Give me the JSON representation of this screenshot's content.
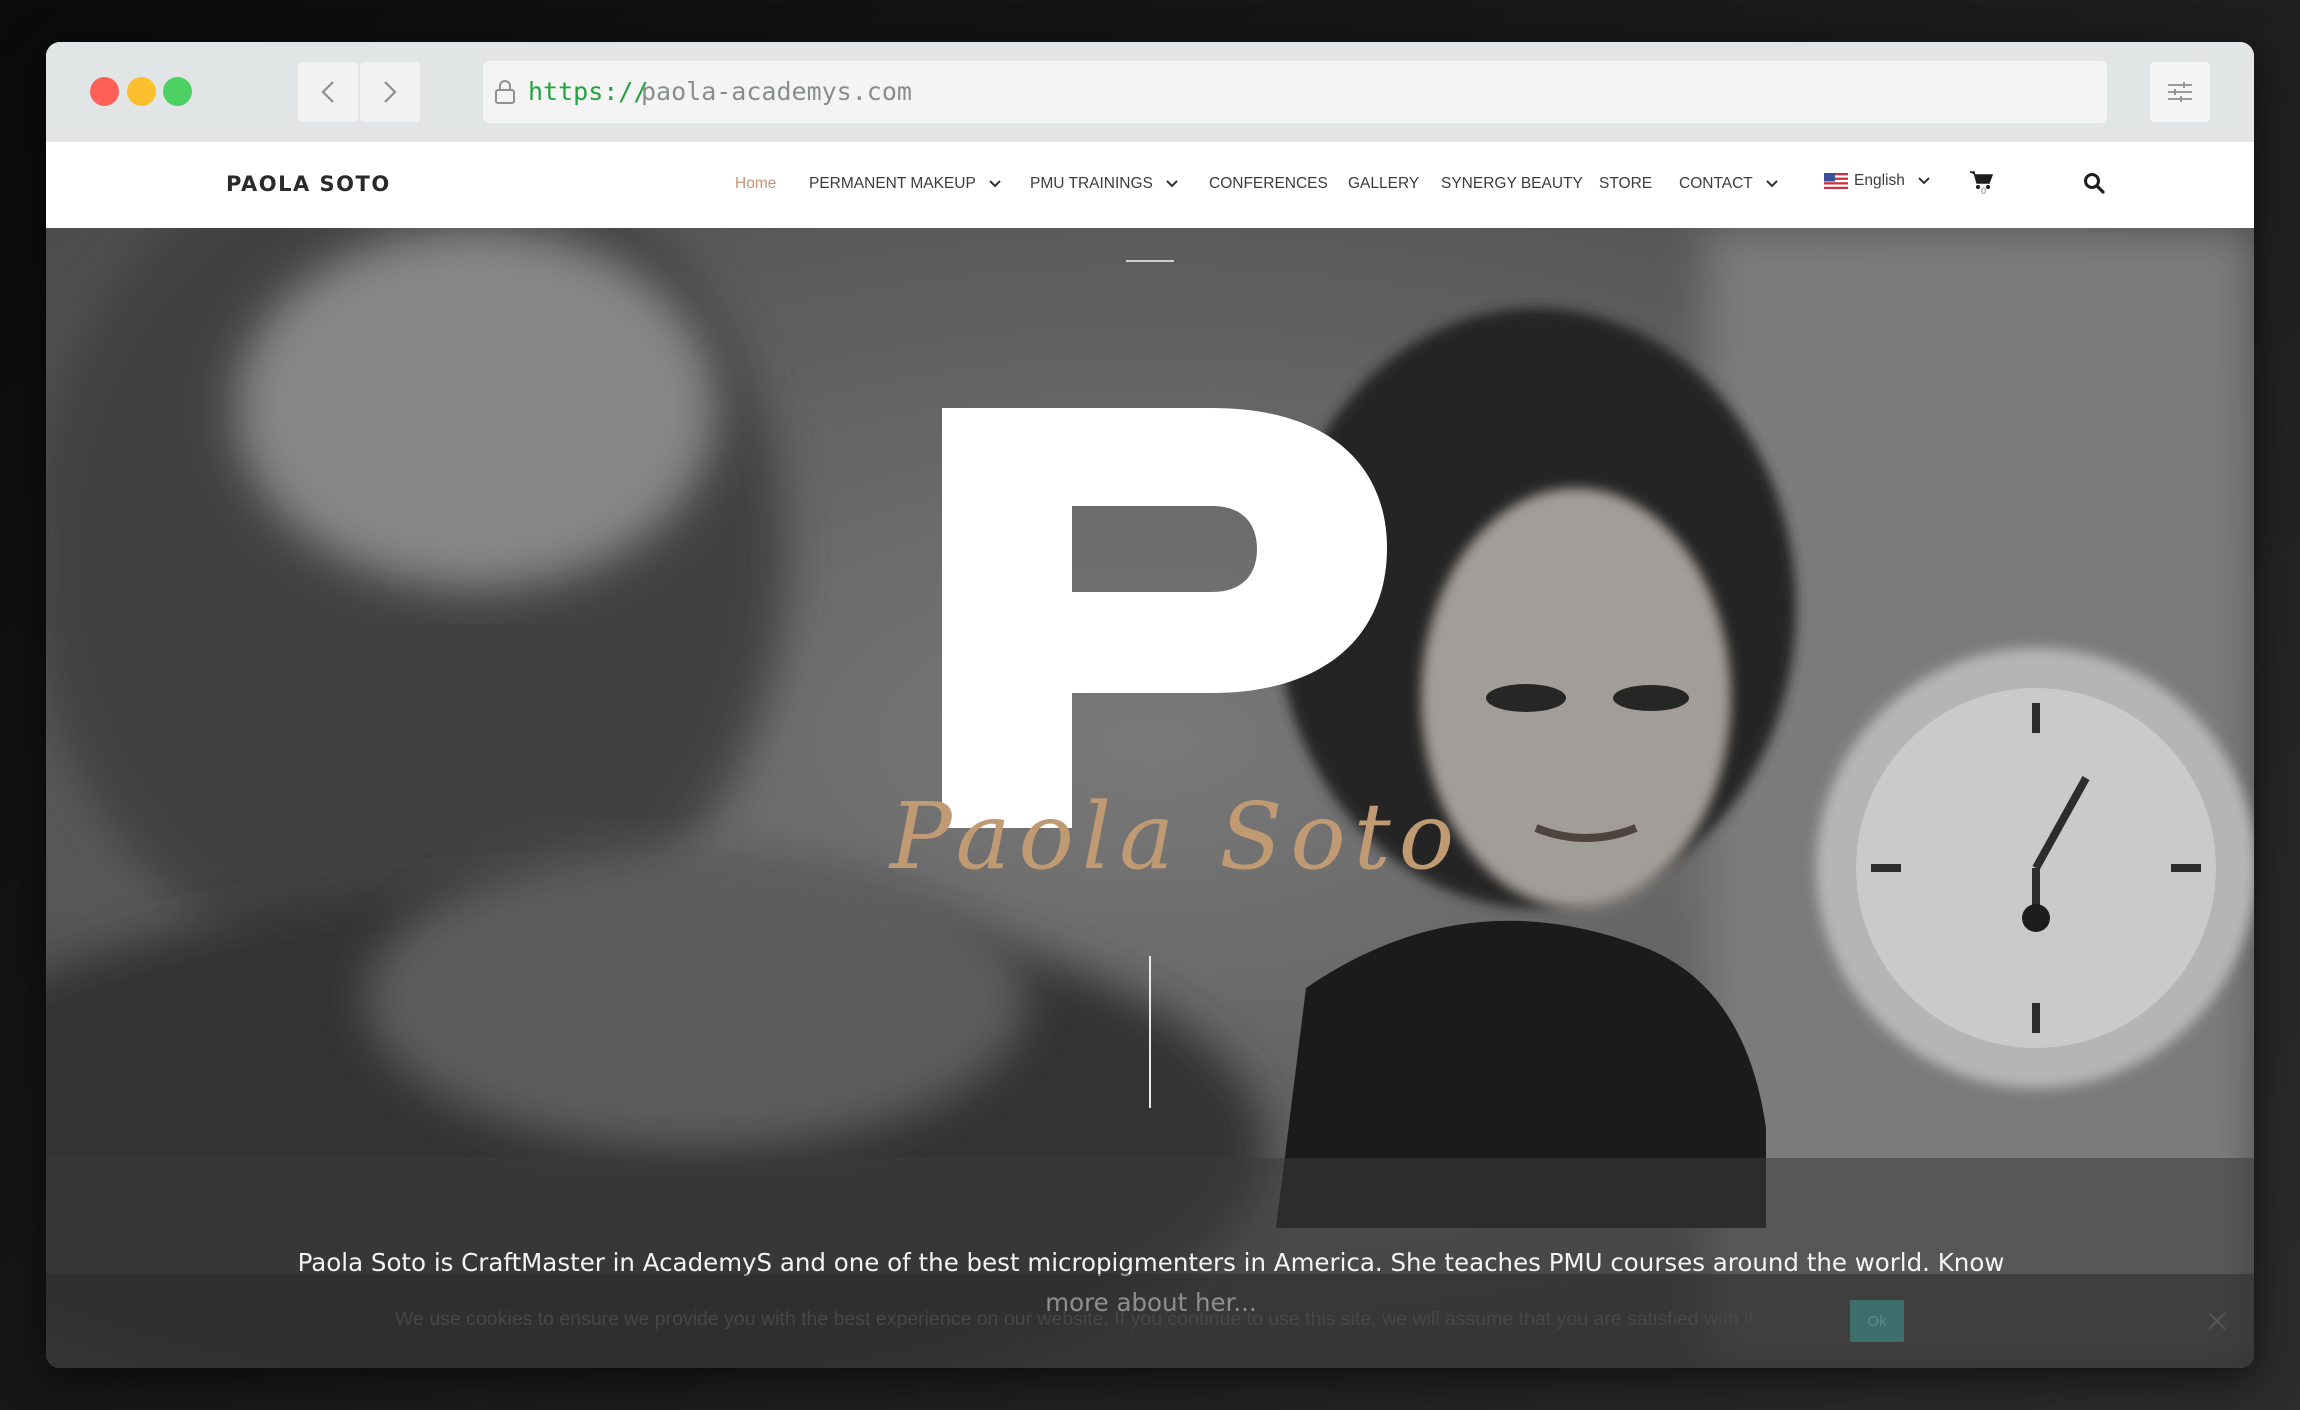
{
  "browser": {
    "url_scheme": "https://",
    "url_host": "paola-academys.com",
    "colors": {
      "close": "#fe6058",
      "minimize": "#fcc02f",
      "maximize": "#4ed163",
      "scheme": "#22a33e"
    }
  },
  "header": {
    "logo": "PAOLA SOTO",
    "menu": [
      {
        "label": "Home",
        "active": true
      },
      {
        "label": "PERMANENT MAKEUP",
        "has_dropdown": true
      },
      {
        "label": "PMU TRAININGS",
        "has_dropdown": true
      },
      {
        "label": "CONFERENCES"
      },
      {
        "label": "GALLERY"
      },
      {
        "label": "SYNERGY BEAUTY"
      },
      {
        "label": "STORE"
      },
      {
        "label": "CONTACT",
        "has_dropdown": true
      }
    ],
    "language": {
      "label": "English",
      "icon": "us-flag-icon"
    },
    "cart": {
      "icon": "cart-icon",
      "count": "0"
    },
    "search_icon": "search-icon",
    "accent_color": "#c49577"
  },
  "hero": {
    "monogram": "P",
    "script_name": "Paola Soto",
    "script_color": "#c09a73",
    "description": "Paola Soto is CraftMaster in AcademyS and one of the best micropigmenters in America. She teaches PMU courses around the world. Know more about her..."
  },
  "cookie_notice": {
    "text": "We use cookies to ensure we provide you with the best experience on our website. If you continue to use this site, we will assume that you are satisfied with it.",
    "ok_label": "Ok",
    "ok_color": "#3e6e6b"
  }
}
